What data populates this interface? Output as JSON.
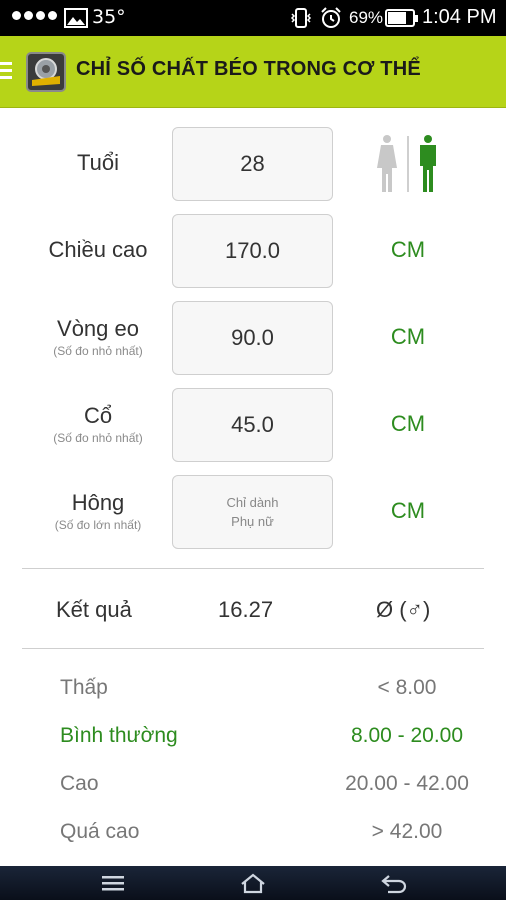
{
  "status_bar": {
    "temperature": "35°",
    "battery_percent": "69%",
    "time": "1:04 PM"
  },
  "app": {
    "title": "CHỈ SỐ CHẤT BÉO TRONG CƠ THỂ",
    "accent_color": "#b6d418",
    "value_color": "#2d8c1f"
  },
  "form": {
    "age": {
      "label": "Tuổi",
      "value": "28"
    },
    "height": {
      "label": "Chiều cao",
      "value": "170.0",
      "unit": "CM"
    },
    "waist": {
      "label": "Vòng eo",
      "sublabel": "(Số đo nhỏ nhất)",
      "value": "90.0",
      "unit": "CM"
    },
    "neck": {
      "label": "Cổ",
      "sublabel": "(Số đo nhỏ nhất)",
      "value": "45.0",
      "unit": "CM"
    },
    "hip": {
      "label": "Hông",
      "sublabel": "(Số đo lớn nhất)",
      "placeholder_line1": "Chỉ dành",
      "placeholder_line2": "Phụ nữ",
      "unit": "CM"
    }
  },
  "gender_selector": {
    "selected": "male",
    "icons": [
      "female-icon",
      "male-icon"
    ]
  },
  "result": {
    "label": "Kết quả",
    "value": "16.27",
    "classification": "Ø (♂)"
  },
  "ranges": [
    {
      "name": "Thấp",
      "value": "< 8.00",
      "active": false
    },
    {
      "name": "Bình thường",
      "value": "8.00 - 20.00",
      "active": true
    },
    {
      "name": "Cao",
      "value": "20.00 - 42.00",
      "active": false
    },
    {
      "name": "Quá cao",
      "value": "> 42.00",
      "active": false
    }
  ],
  "nav_bar": {
    "icons": [
      "recent-apps-icon",
      "home-icon",
      "back-icon"
    ]
  }
}
